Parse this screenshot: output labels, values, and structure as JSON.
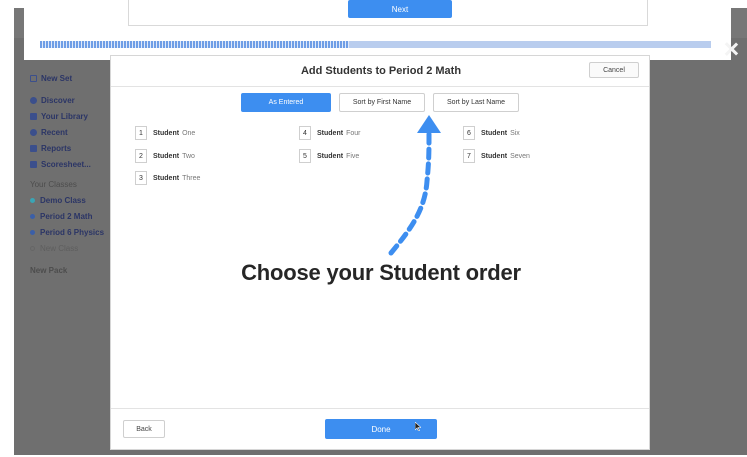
{
  "background_panel": {
    "next_label": "Next"
  },
  "progress": {
    "fraction": 0.46
  },
  "sidebar": {
    "new_set": "New Set",
    "items": [
      {
        "label": "Discover",
        "icon": "compass-icon"
      },
      {
        "label": "Your Library",
        "icon": "folder-icon"
      },
      {
        "label": "Recent",
        "icon": "clock-icon"
      },
      {
        "label": "Reports",
        "icon": "report-icon"
      },
      {
        "label": "Scoresheet...",
        "icon": "grid-icon"
      }
    ],
    "classes_heading": "Your Classes",
    "classes": [
      {
        "label": "Demo Class",
        "color": "#3aa5b5"
      },
      {
        "label": "Period 2 Math",
        "color": "#3b5fa8"
      },
      {
        "label": "Period 6 Physics",
        "color": "#3b5fa8"
      }
    ],
    "new_class": "New Class",
    "new_pack": "New Pack"
  },
  "modal": {
    "title": "Add Students to Period 2 Math",
    "cancel_label": "Cancel",
    "sort_options": {
      "as_entered": "As Entered",
      "first_name": "Sort by First Name",
      "last_name": "Sort by Last Name"
    },
    "active_sort": "As Entered",
    "students": [
      {
        "number": "1",
        "first": "Student",
        "last": "One"
      },
      {
        "number": "2",
        "first": "Student",
        "last": "Two"
      },
      {
        "number": "3",
        "first": "Student",
        "last": "Three"
      },
      {
        "number": "4",
        "first": "Student",
        "last": "Four"
      },
      {
        "number": "5",
        "first": "Student",
        "last": "Five"
      },
      {
        "number": "6",
        "first": "Student",
        "last": "Six"
      },
      {
        "number": "7",
        "first": "Student",
        "last": "Seven"
      }
    ],
    "annotation": "Choose your Student order",
    "back_label": "Back",
    "done_label": "Done"
  },
  "colors": {
    "accent": "#3d8ef0",
    "overlay": "#6f6f6f",
    "annotation_arrow": "#3d8ef0"
  }
}
